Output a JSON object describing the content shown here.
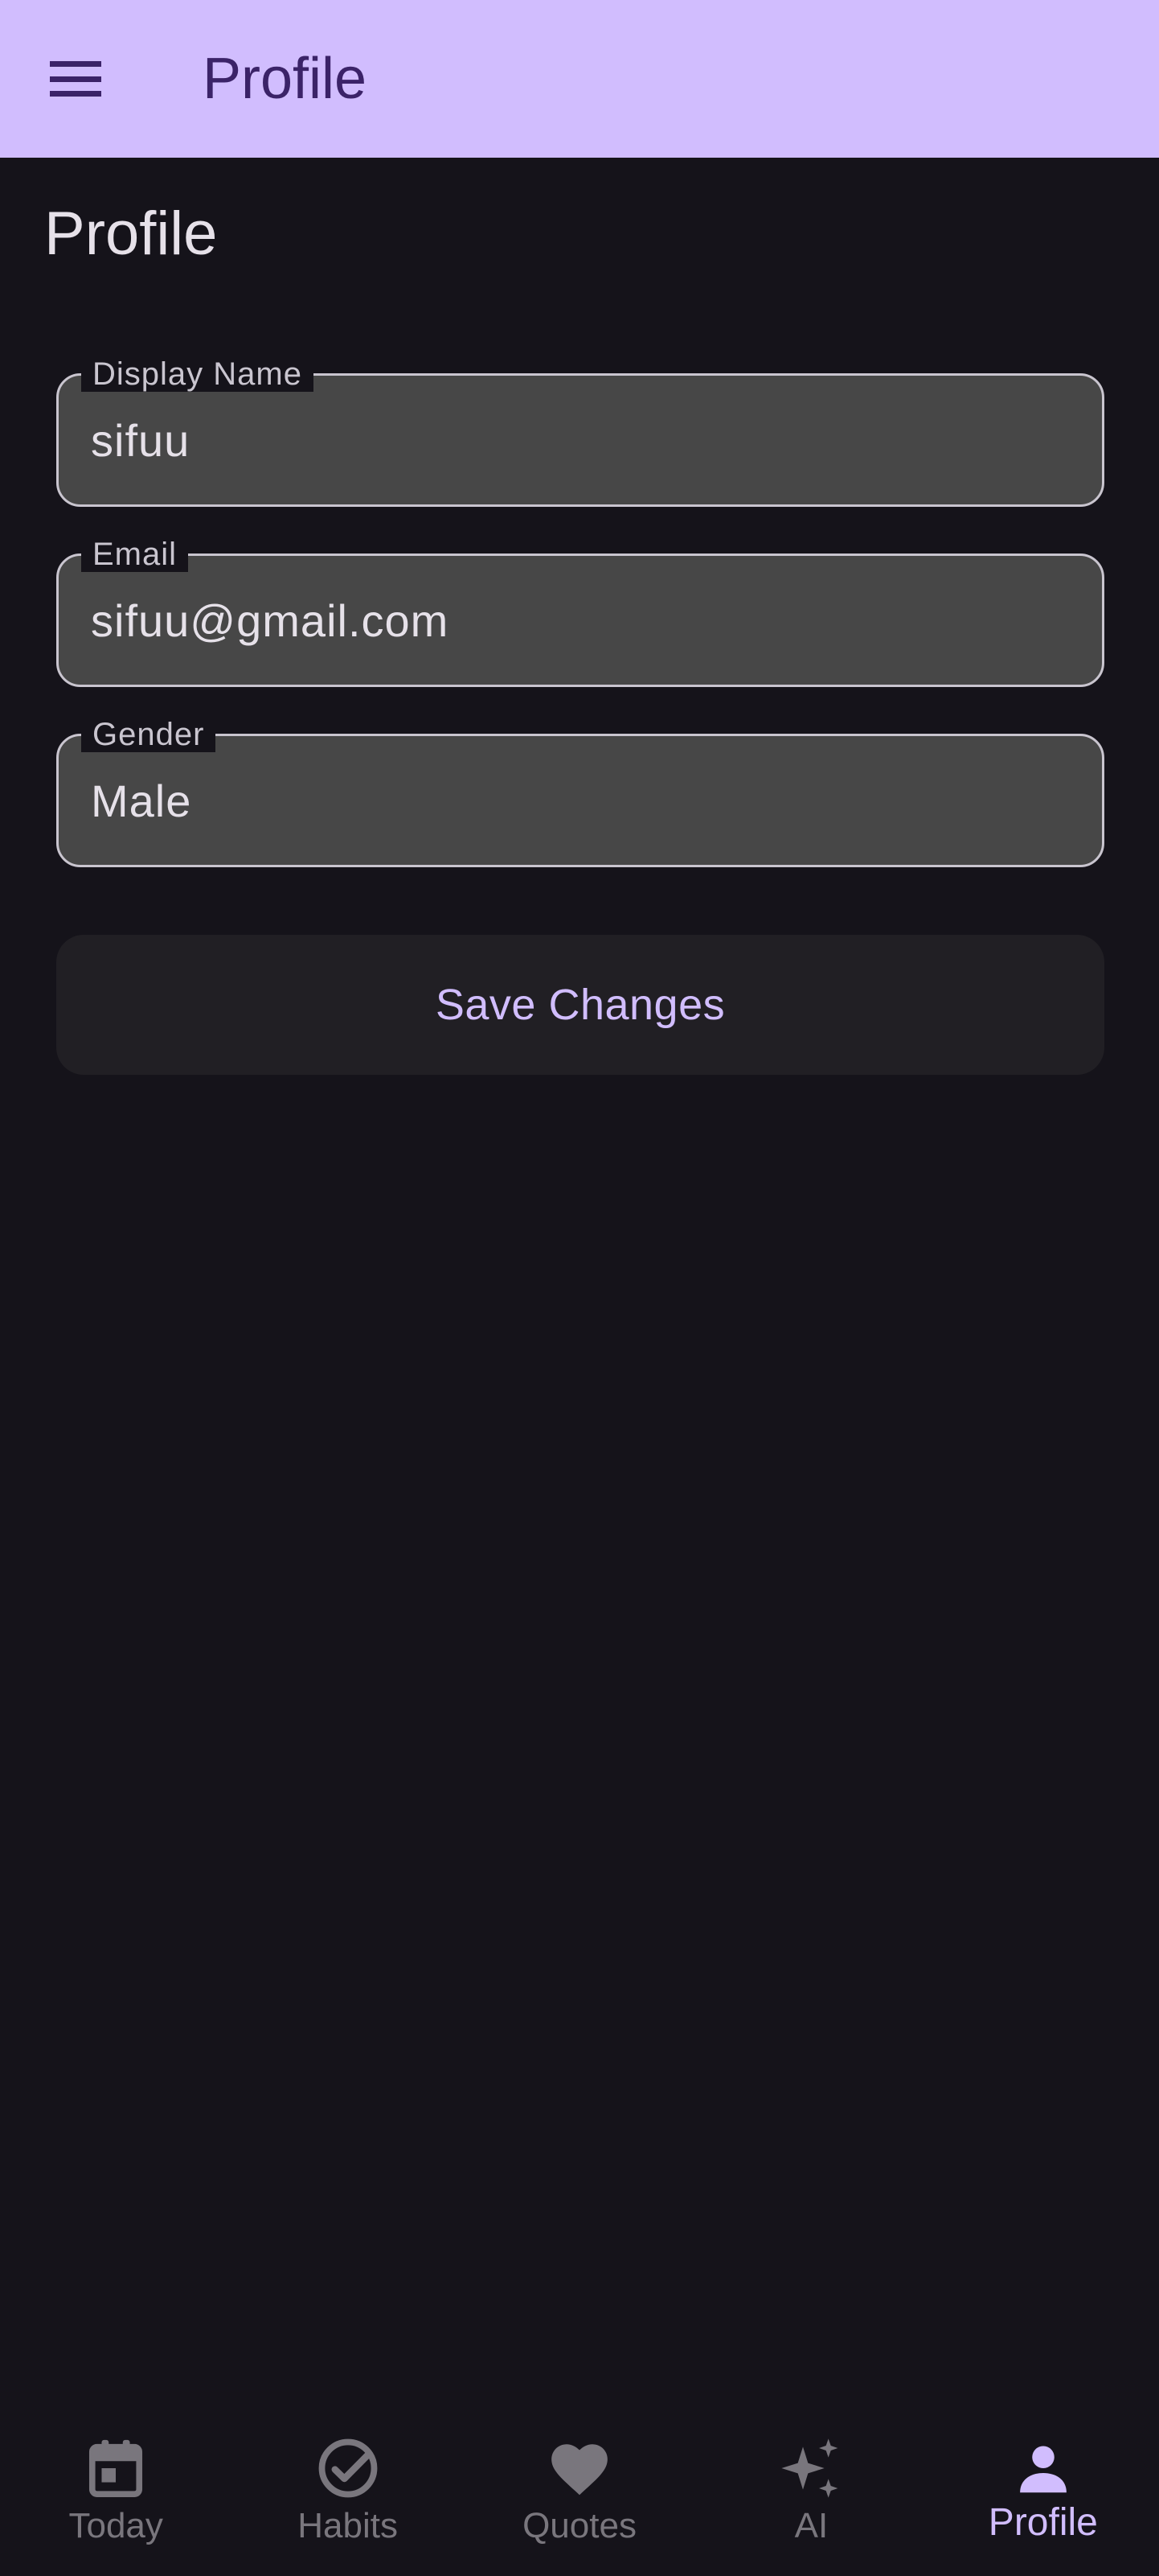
{
  "appbar": {
    "title": "Profile",
    "menu_icon": "hamburger-menu-icon",
    "background": "#d1bdfe",
    "title_color": "#3b2368"
  },
  "page": {
    "title": "Profile",
    "background": "#15131a"
  },
  "form": {
    "display_name": {
      "label": "Display Name",
      "value": "sifuu"
    },
    "email": {
      "label": "Email",
      "value": "sifuu@gmail.com"
    },
    "gender": {
      "label": "Gender",
      "value": "Male"
    }
  },
  "actions": {
    "save_label": "Save Changes",
    "accent": "#d1bdfe"
  },
  "bottom_nav": {
    "active_index": 4,
    "items": [
      {
        "label": "Today",
        "icon": "calendar-icon"
      },
      {
        "label": "Habits",
        "icon": "check-circle-icon"
      },
      {
        "label": "Quotes",
        "icon": "heart-icon"
      },
      {
        "label": "AI",
        "icon": "sparkles-icon"
      },
      {
        "label": "Profile",
        "icon": "person-icon"
      }
    ],
    "inactive_color": "#79767d",
    "active_color": "#d1bdfe"
  }
}
